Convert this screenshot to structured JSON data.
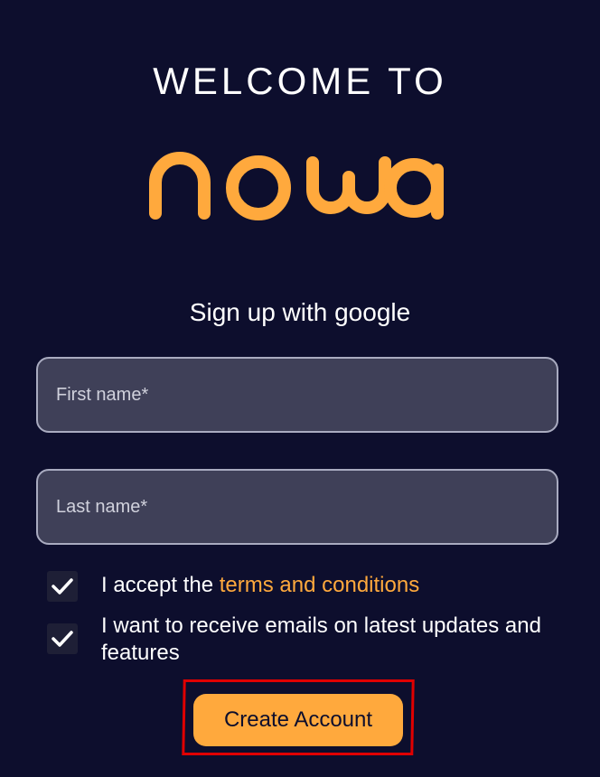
{
  "header": {
    "welcome_text": "WELCOME TO",
    "brand": "nowa"
  },
  "signup": {
    "google_label": "Sign up with google"
  },
  "form": {
    "first_name_placeholder": "First name*",
    "last_name_placeholder": "Last name*",
    "terms_prefix": "I accept the ",
    "terms_link": "terms and conditions",
    "emails_label": "I want to receive emails on latest updates and features",
    "terms_checked": true,
    "emails_checked": true
  },
  "actions": {
    "create_account_label": "Create Account"
  },
  "colors": {
    "background": "#0d0e2d",
    "accent": "#ffa93d",
    "field_background": "#3f4058",
    "highlight": "#e00000"
  }
}
